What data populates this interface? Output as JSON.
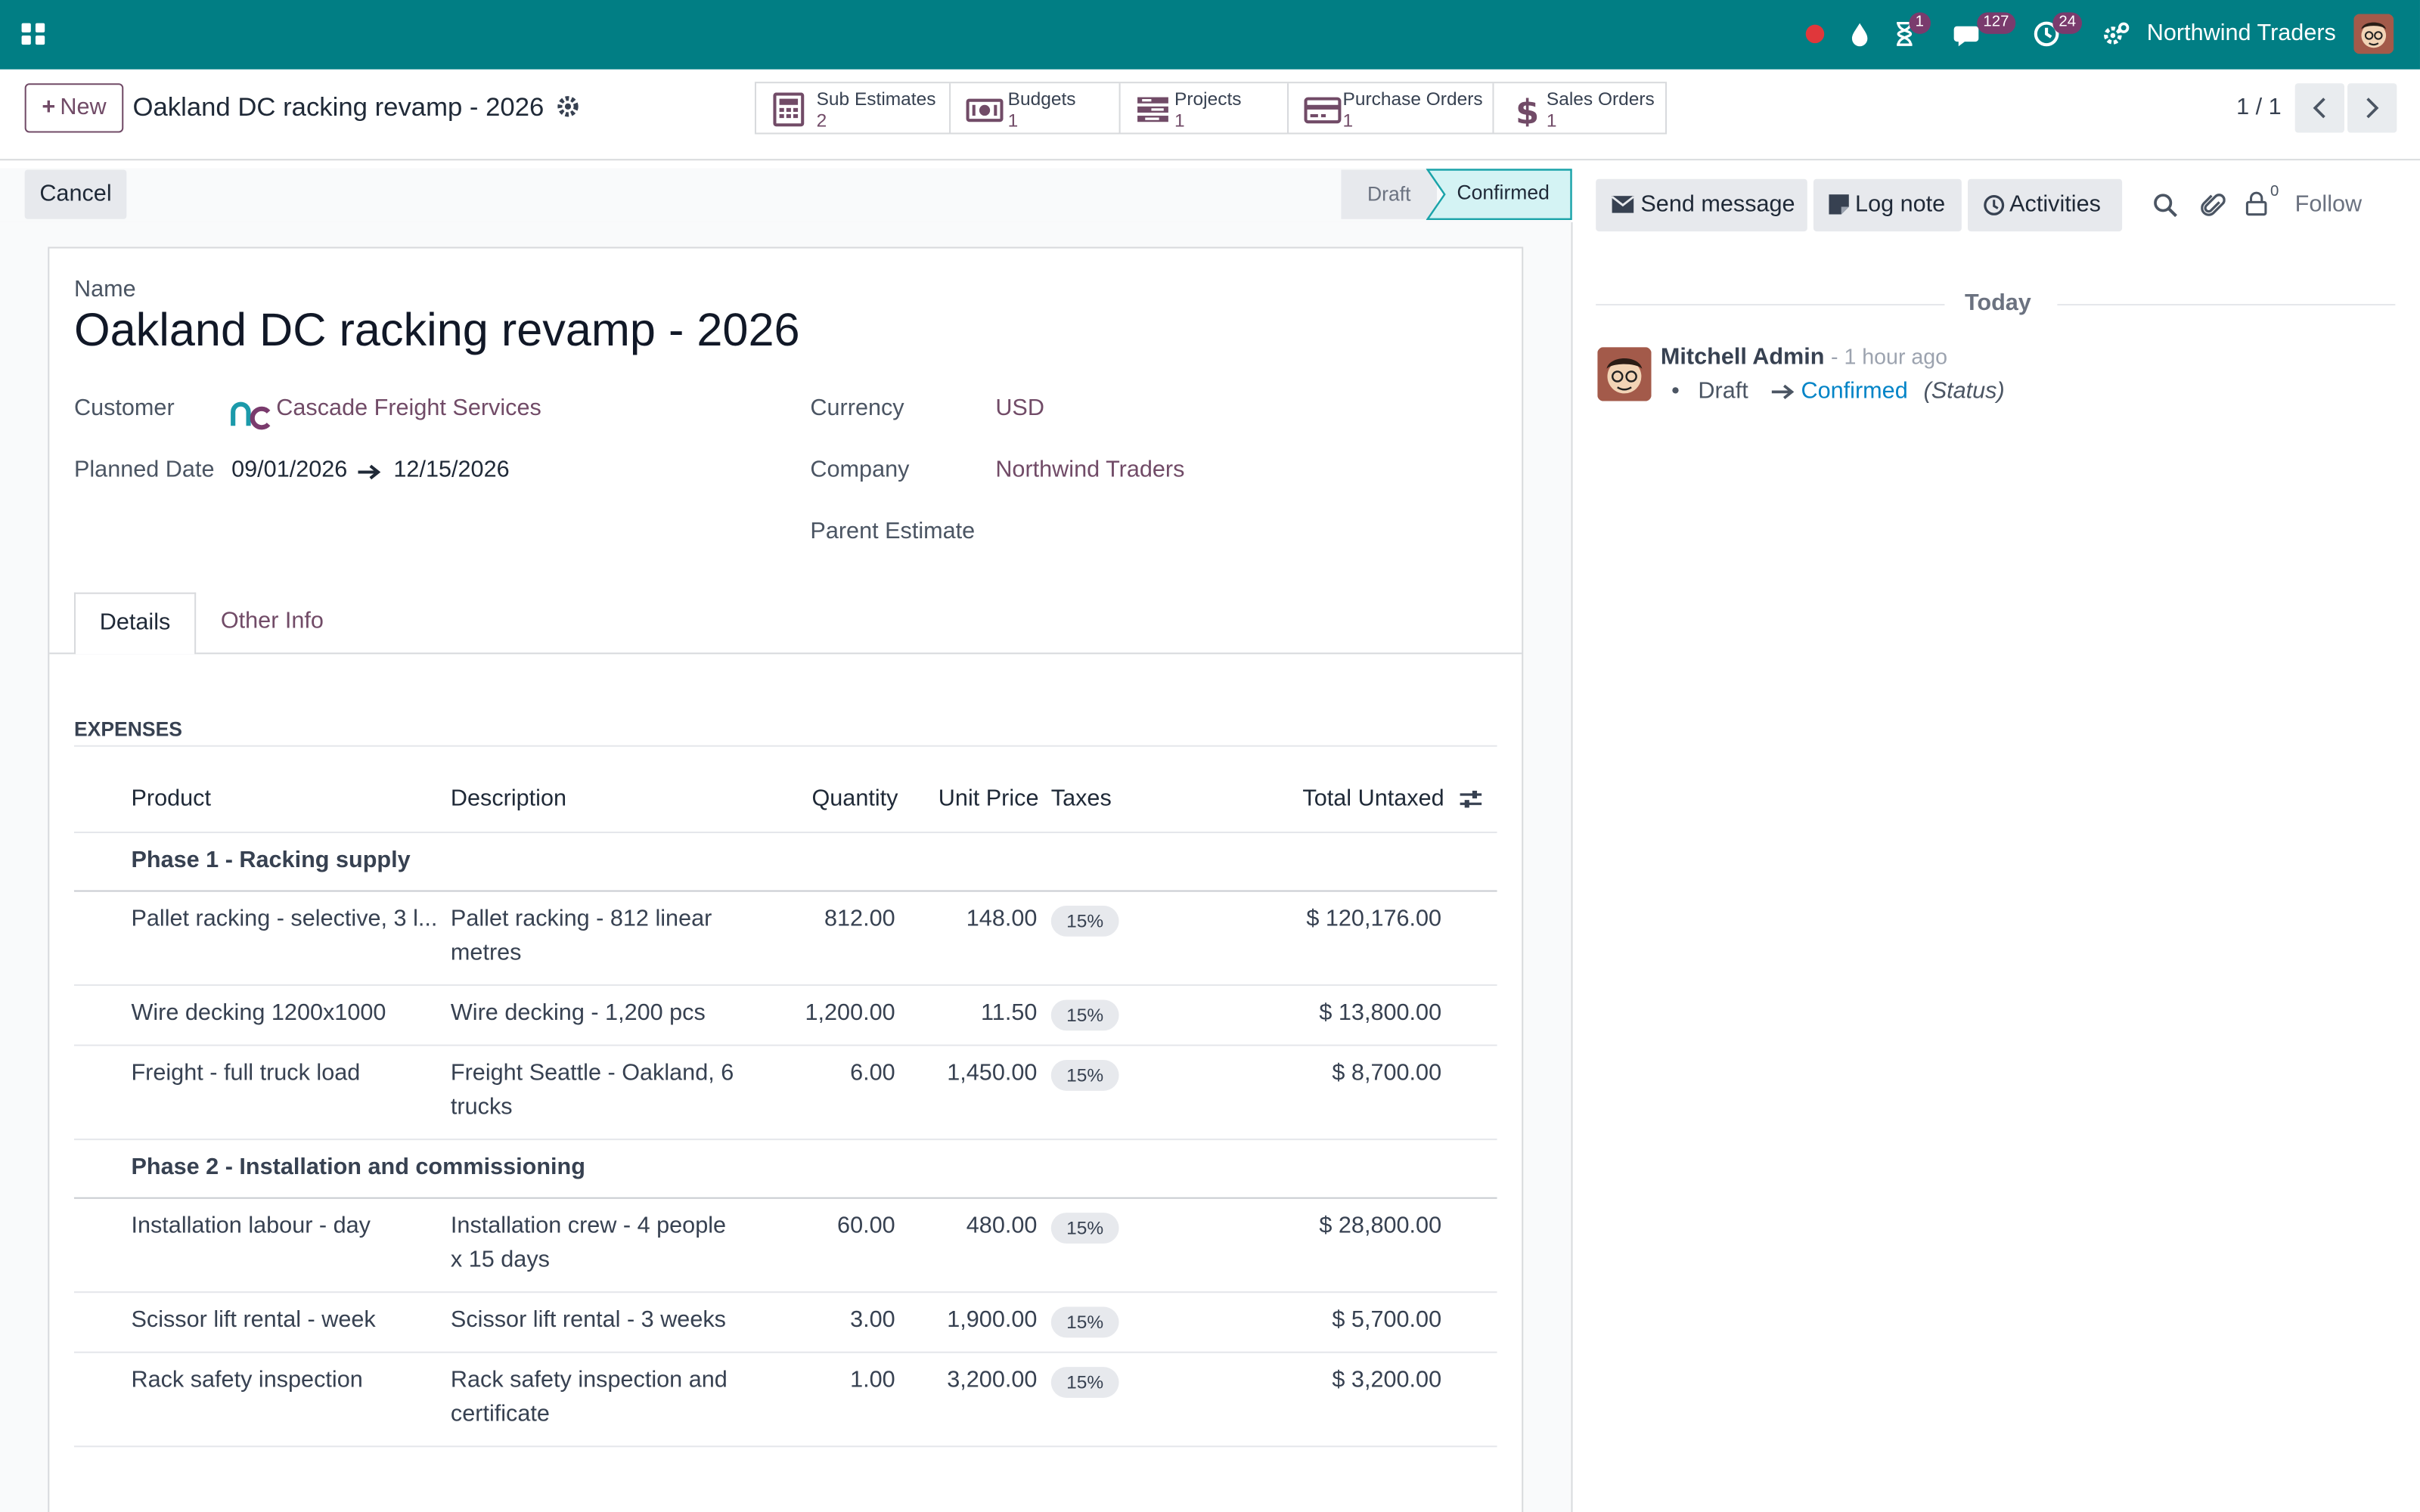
{
  "navbar": {
    "company": "Northwind Traders",
    "activity_badge": "1",
    "messages_badge": "127",
    "clock_badge": "24",
    "colors": {
      "bar": "#017e84",
      "badge": "#7a3b6d"
    }
  },
  "control_panel": {
    "new_label": "New",
    "record_title": "Oakland DC racking revamp - 2026",
    "pager": "1 / 1",
    "smart_buttons": [
      {
        "label": "Sub Estimates",
        "count": "2",
        "icon": "calculator-icon"
      },
      {
        "label": "Budgets",
        "count": "1",
        "icon": "money-icon"
      },
      {
        "label": "Projects",
        "count": "1",
        "icon": "tasks-icon"
      },
      {
        "label": "Purchase Orders",
        "count": "1",
        "icon": "credit-card-icon"
      },
      {
        "label": "Sales Orders",
        "count": "1",
        "icon": "dollar-icon"
      }
    ]
  },
  "status_bar": {
    "cancel_label": "Cancel",
    "stages": [
      "Draft",
      "Confirmed"
    ],
    "current_stage": "Confirmed"
  },
  "form": {
    "name_label": "Name",
    "name": "Oakland DC racking revamp - 2026",
    "customer_label": "Customer",
    "customer": "Cascade Freight Services",
    "planned_date_label": "Planned Date",
    "planned_start": "09/01/2026",
    "planned_end": "12/15/2026",
    "currency_label": "Currency",
    "currency": "USD",
    "company_label": "Company",
    "company": "Northwind Traders",
    "parent_label": "Parent Estimate",
    "tabs": [
      "Details",
      "Other Info"
    ],
    "active_tab": "Details",
    "section_title": "EXPENSES",
    "columns": [
      "Product",
      "Description",
      "Quantity",
      "Unit Price",
      "Taxes",
      "Total Untaxed"
    ],
    "sections": [
      {
        "name": "Phase 1 - Racking supply",
        "lines": [
          {
            "product": "Pallet racking - selective, 3 l...",
            "description": "Pallet racking - 812 linear metres",
            "quantity": "812.00",
            "unit_price": "148.00",
            "tax": "15%",
            "total": "$ 120,176.00"
          },
          {
            "product": "Wire decking 1200x1000",
            "description": "Wire decking - 1,200 pcs",
            "quantity": "1,200.00",
            "unit_price": "11.50",
            "tax": "15%",
            "total": "$ 13,800.00"
          },
          {
            "product": "Freight - full truck load",
            "description": "Freight Seattle - Oakland, 6 trucks",
            "quantity": "6.00",
            "unit_price": "1,450.00",
            "tax": "15%",
            "total": "$ 8,700.00"
          }
        ]
      },
      {
        "name": "Phase 2 - Installation and commissioning",
        "lines": [
          {
            "product": "Installation labour - day",
            "description": "Installation crew - 4 people x 15 days",
            "quantity": "60.00",
            "unit_price": "480.00",
            "tax": "15%",
            "total": "$ 28,800.00"
          },
          {
            "product": "Scissor lift rental - week",
            "description": "Scissor lift rental - 3 weeks",
            "quantity": "3.00",
            "unit_price": "1,900.00",
            "tax": "15%",
            "total": "$ 5,700.00"
          },
          {
            "product": "Rack safety inspection",
            "description": "Rack safety inspection and certificate",
            "quantity": "1.00",
            "unit_price": "3,200.00",
            "tax": "15%",
            "total": "$ 3,200.00"
          }
        ]
      }
    ]
  },
  "chatter": {
    "send_message": "Send message",
    "log_note": "Log note",
    "activities": "Activities",
    "followers_count": "0",
    "follow": "Follow",
    "day_separator": "Today",
    "message": {
      "author": "Mitchell Admin",
      "time": "- 1 hour ago",
      "old_value": "Draft",
      "new_value": "Confirmed",
      "field": "(Status)"
    }
  }
}
